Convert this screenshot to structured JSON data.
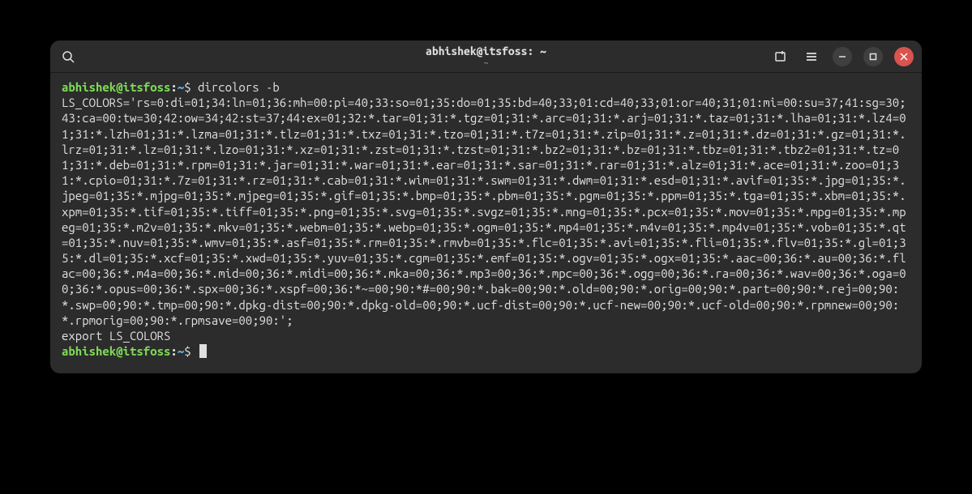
{
  "titlebar": {
    "title": "abhishek@itsfoss: ~",
    "subtitle": "~"
  },
  "prompt": {
    "user_host": "abhishek@itsfoss",
    "colon": ":",
    "tilde": "~",
    "dollar": "$ "
  },
  "command": "dircolors -b",
  "output_line1": "LS_COLORS='rs=0:di=01;34:ln=01;36:mh=00:pi=40;33:so=01;35:do=01;35:bd=40;33;01:cd=40;33;01:or=40;31;01:mi=00:su=37;41:sg=30;43:ca=00:tw=30;42:ow=34;42:st=37;44:ex=01;32:*.tar=01;31:*.tgz=01;31:*.arc=01;31:*.arj=01;31:*.taz=01;31:*.lha=01;31:*.lz4=01;31:*.lzh=01;31:*.lzma=01;31:*.tlz=01;31:*.txz=01;31:*.tzo=01;31:*.t7z=01;31:*.zip=01;31:*.z=01;31:*.dz=01;31:*.gz=01;31:*.lrz=01;31:*.lz=01;31:*.lzo=01;31:*.xz=01;31:*.zst=01;31:*.tzst=01;31:*.bz2=01;31:*.bz=01;31:*.tbz=01;31:*.tbz2=01;31:*.tz=01;31:*.deb=01;31:*.rpm=01;31:*.jar=01;31:*.war=01;31:*.ear=01;31:*.sar=01;31:*.rar=01;31:*.alz=01;31:*.ace=01;31:*.zoo=01;31:*.cpio=01;31:*.7z=01;31:*.rz=01;31:*.cab=01;31:*.wim=01;31:*.swm=01;31:*.dwm=01;31:*.esd=01;31:*.avif=01;35:*.jpg=01;35:*.jpeg=01;35:*.mjpg=01;35:*.mjpeg=01;35:*.gif=01;35:*.bmp=01;35:*.pbm=01;35:*.pgm=01;35:*.ppm=01;35:*.tga=01;35:*.xbm=01;35:*.xpm=01;35:*.tif=01;35:*.tiff=01;35:*.png=01;35:*.svg=01;35:*.svgz=01;35:*.mng=01;35:*.pcx=01;35:*.mov=01;35:*.mpg=01;35:*.mpeg=01;35:*.m2v=01;35:*.mkv=01;35:*.webm=01;35:*.webp=01;35:*.ogm=01;35:*.mp4=01;35:*.m4v=01;35:*.mp4v=01;35:*.vob=01;35:*.qt=01;35:*.nuv=01;35:*.wmv=01;35:*.asf=01;35:*.rm=01;35:*.rmvb=01;35:*.flc=01;35:*.avi=01;35:*.fli=01;35:*.flv=01;35:*.gl=01;35:*.dl=01;35:*.xcf=01;35:*.xwd=01;35:*.yuv=01;35:*.cgm=01;35:*.emf=01;35:*.ogv=01;35:*.ogx=01;35:*.aac=00;36:*.au=00;36:*.flac=00;36:*.m4a=00;36:*.mid=00;36:*.midi=00;36:*.mka=00;36:*.mp3=00;36:*.mpc=00;36:*.ogg=00;36:*.ra=00;36:*.wav=00;36:*.oga=00;36:*.opus=00;36:*.spx=00;36:*.xspf=00;36:*~=00;90:*#=00;90:*.bak=00;90:*.old=00;90:*.orig=00;90:*.part=00;90:*.rej=00;90:*.swp=00;90:*.tmp=00;90:*.dpkg-dist=00;90:*.dpkg-old=00;90:*.ucf-dist=00;90:*.ucf-new=00;90:*.ucf-old=00;90:*.rpmnew=00;90:*.rpmorig=00;90:*.rpmsave=00;90:';",
  "output_line2": "export LS_COLORS"
}
